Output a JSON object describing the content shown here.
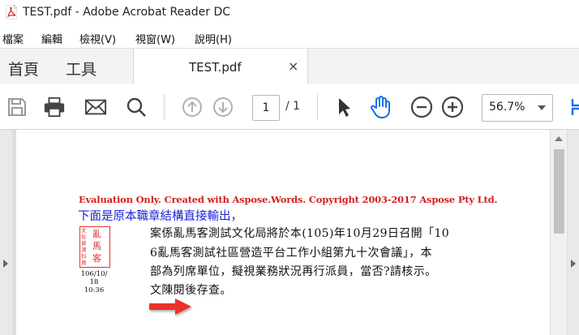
{
  "window": {
    "title": "TEST.pdf - Adobe Acrobat Reader DC"
  },
  "menu": {
    "items": [
      "檔案",
      "編輯",
      "檢視(V)",
      "視窗(W)",
      "說明(H)"
    ]
  },
  "tabs": {
    "home": "首頁",
    "tools": "工具",
    "document": "TEST.pdf",
    "close": "×"
  },
  "toolbar": {
    "save_icon": "save-icon",
    "print_icon": "print-icon",
    "email_icon": "email-icon",
    "search_icon": "search-icon",
    "page_up_icon": "page-up-icon",
    "page_down_icon": "page-down-icon",
    "current_page": "1",
    "total_pages": "/ 1",
    "select_icon": "cursor-icon",
    "hand_icon": "hand-icon",
    "zoom_out_icon": "zoom-out-icon",
    "zoom_in_icon": "zoom-in-icon",
    "zoom": "56.7%",
    "accent": "#1473e6"
  },
  "document": {
    "evaluation_notice": "Evaluation Only. Created with Aspose.Words. Copyright 2003-2017 Aspose Pty Ltd.",
    "blue_line": "下面是原本職章結構直接輸出，",
    "stamp": {
      "small_chars": "文化資源科員",
      "big_chars": "亂馬客",
      "date_line1": "106/10/",
      "date_line2": "18",
      "date_line3": "10:36"
    },
    "body_lines": [
      "案係亂馬客測試文化局將於本(105)年10月29日召開「10",
      "6亂馬客測試社區營造平台工作小組第九十次會議」，本",
      "部為列席單位，擬視業務狀況再行派員，當否?請核示。",
      "文陳閱後存查。"
    ],
    "eval_color": "#d32020",
    "blue_color": "#2020d8",
    "stamp_color": "#dd3333",
    "arrow_color": "#e8302a"
  }
}
